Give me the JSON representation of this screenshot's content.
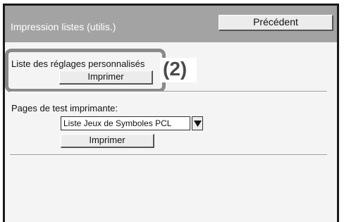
{
  "window": {
    "title": "Impression listes (utilis.)",
    "back_label": "Précédent"
  },
  "user_settings": {
    "label": "Liste des réglages personnalisés",
    "print_label": "Imprimer",
    "callout": "(2)"
  },
  "test_pages": {
    "label": "Pages de test imprimante:",
    "selected_option": "Liste Jeux de Symboles PCL",
    "print_label": "Imprimer"
  },
  "colors": {
    "header": "#a3a3a3",
    "panel": "#f4f4f4",
    "highlight": "#8a8a8a"
  },
  "icons": {
    "dropdown": "triangle-down-icon"
  }
}
